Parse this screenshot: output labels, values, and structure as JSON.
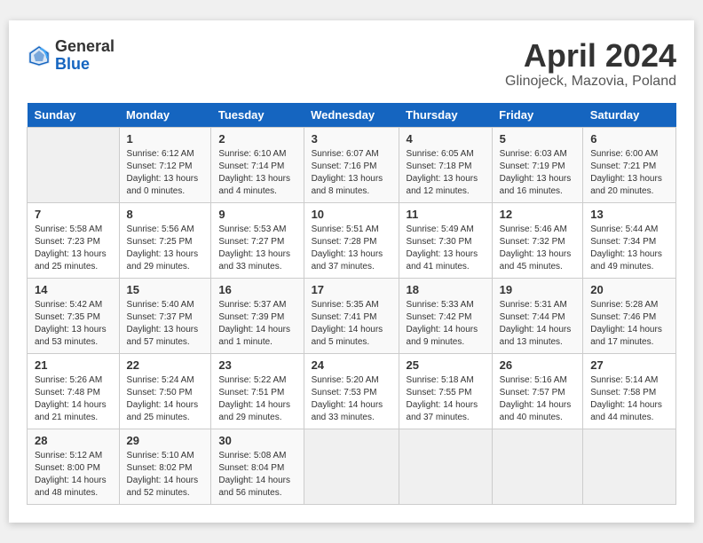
{
  "header": {
    "logo_general": "General",
    "logo_blue": "Blue",
    "month_year": "April 2024",
    "location": "Glinojeck, Mazovia, Poland"
  },
  "weekdays": [
    "Sunday",
    "Monday",
    "Tuesday",
    "Wednesday",
    "Thursday",
    "Friday",
    "Saturday"
  ],
  "weeks": [
    [
      {
        "day": "",
        "empty": true
      },
      {
        "day": "1",
        "sunrise": "6:12 AM",
        "sunset": "7:12 PM",
        "daylight": "13 hours and 0 minutes."
      },
      {
        "day": "2",
        "sunrise": "6:10 AM",
        "sunset": "7:14 PM",
        "daylight": "13 hours and 4 minutes."
      },
      {
        "day": "3",
        "sunrise": "6:07 AM",
        "sunset": "7:16 PM",
        "daylight": "13 hours and 8 minutes."
      },
      {
        "day": "4",
        "sunrise": "6:05 AM",
        "sunset": "7:18 PM",
        "daylight": "13 hours and 12 minutes."
      },
      {
        "day": "5",
        "sunrise": "6:03 AM",
        "sunset": "7:19 PM",
        "daylight": "13 hours and 16 minutes."
      },
      {
        "day": "6",
        "sunrise": "6:00 AM",
        "sunset": "7:21 PM",
        "daylight": "13 hours and 20 minutes."
      }
    ],
    [
      {
        "day": "7",
        "sunrise": "5:58 AM",
        "sunset": "7:23 PM",
        "daylight": "13 hours and 25 minutes."
      },
      {
        "day": "8",
        "sunrise": "5:56 AM",
        "sunset": "7:25 PM",
        "daylight": "13 hours and 29 minutes."
      },
      {
        "day": "9",
        "sunrise": "5:53 AM",
        "sunset": "7:27 PM",
        "daylight": "13 hours and 33 minutes."
      },
      {
        "day": "10",
        "sunrise": "5:51 AM",
        "sunset": "7:28 PM",
        "daylight": "13 hours and 37 minutes."
      },
      {
        "day": "11",
        "sunrise": "5:49 AM",
        "sunset": "7:30 PM",
        "daylight": "13 hours and 41 minutes."
      },
      {
        "day": "12",
        "sunrise": "5:46 AM",
        "sunset": "7:32 PM",
        "daylight": "13 hours and 45 minutes."
      },
      {
        "day": "13",
        "sunrise": "5:44 AM",
        "sunset": "7:34 PM",
        "daylight": "13 hours and 49 minutes."
      }
    ],
    [
      {
        "day": "14",
        "sunrise": "5:42 AM",
        "sunset": "7:35 PM",
        "daylight": "13 hours and 53 minutes."
      },
      {
        "day": "15",
        "sunrise": "5:40 AM",
        "sunset": "7:37 PM",
        "daylight": "13 hours and 57 minutes."
      },
      {
        "day": "16",
        "sunrise": "5:37 AM",
        "sunset": "7:39 PM",
        "daylight": "14 hours and 1 minute."
      },
      {
        "day": "17",
        "sunrise": "5:35 AM",
        "sunset": "7:41 PM",
        "daylight": "14 hours and 5 minutes."
      },
      {
        "day": "18",
        "sunrise": "5:33 AM",
        "sunset": "7:42 PM",
        "daylight": "14 hours and 9 minutes."
      },
      {
        "day": "19",
        "sunrise": "5:31 AM",
        "sunset": "7:44 PM",
        "daylight": "14 hours and 13 minutes."
      },
      {
        "day": "20",
        "sunrise": "5:28 AM",
        "sunset": "7:46 PM",
        "daylight": "14 hours and 17 minutes."
      }
    ],
    [
      {
        "day": "21",
        "sunrise": "5:26 AM",
        "sunset": "7:48 PM",
        "daylight": "14 hours and 21 minutes."
      },
      {
        "day": "22",
        "sunrise": "5:24 AM",
        "sunset": "7:50 PM",
        "daylight": "14 hours and 25 minutes."
      },
      {
        "day": "23",
        "sunrise": "5:22 AM",
        "sunset": "7:51 PM",
        "daylight": "14 hours and 29 minutes."
      },
      {
        "day": "24",
        "sunrise": "5:20 AM",
        "sunset": "7:53 PM",
        "daylight": "14 hours and 33 minutes."
      },
      {
        "day": "25",
        "sunrise": "5:18 AM",
        "sunset": "7:55 PM",
        "daylight": "14 hours and 37 minutes."
      },
      {
        "day": "26",
        "sunrise": "5:16 AM",
        "sunset": "7:57 PM",
        "daylight": "14 hours and 40 minutes."
      },
      {
        "day": "27",
        "sunrise": "5:14 AM",
        "sunset": "7:58 PM",
        "daylight": "14 hours and 44 minutes."
      }
    ],
    [
      {
        "day": "28",
        "sunrise": "5:12 AM",
        "sunset": "8:00 PM",
        "daylight": "14 hours and 48 minutes."
      },
      {
        "day": "29",
        "sunrise": "5:10 AM",
        "sunset": "8:02 PM",
        "daylight": "14 hours and 52 minutes."
      },
      {
        "day": "30",
        "sunrise": "5:08 AM",
        "sunset": "8:04 PM",
        "daylight": "14 hours and 56 minutes."
      },
      {
        "day": "",
        "empty": true
      },
      {
        "day": "",
        "empty": true
      },
      {
        "day": "",
        "empty": true
      },
      {
        "day": "",
        "empty": true
      }
    ]
  ]
}
